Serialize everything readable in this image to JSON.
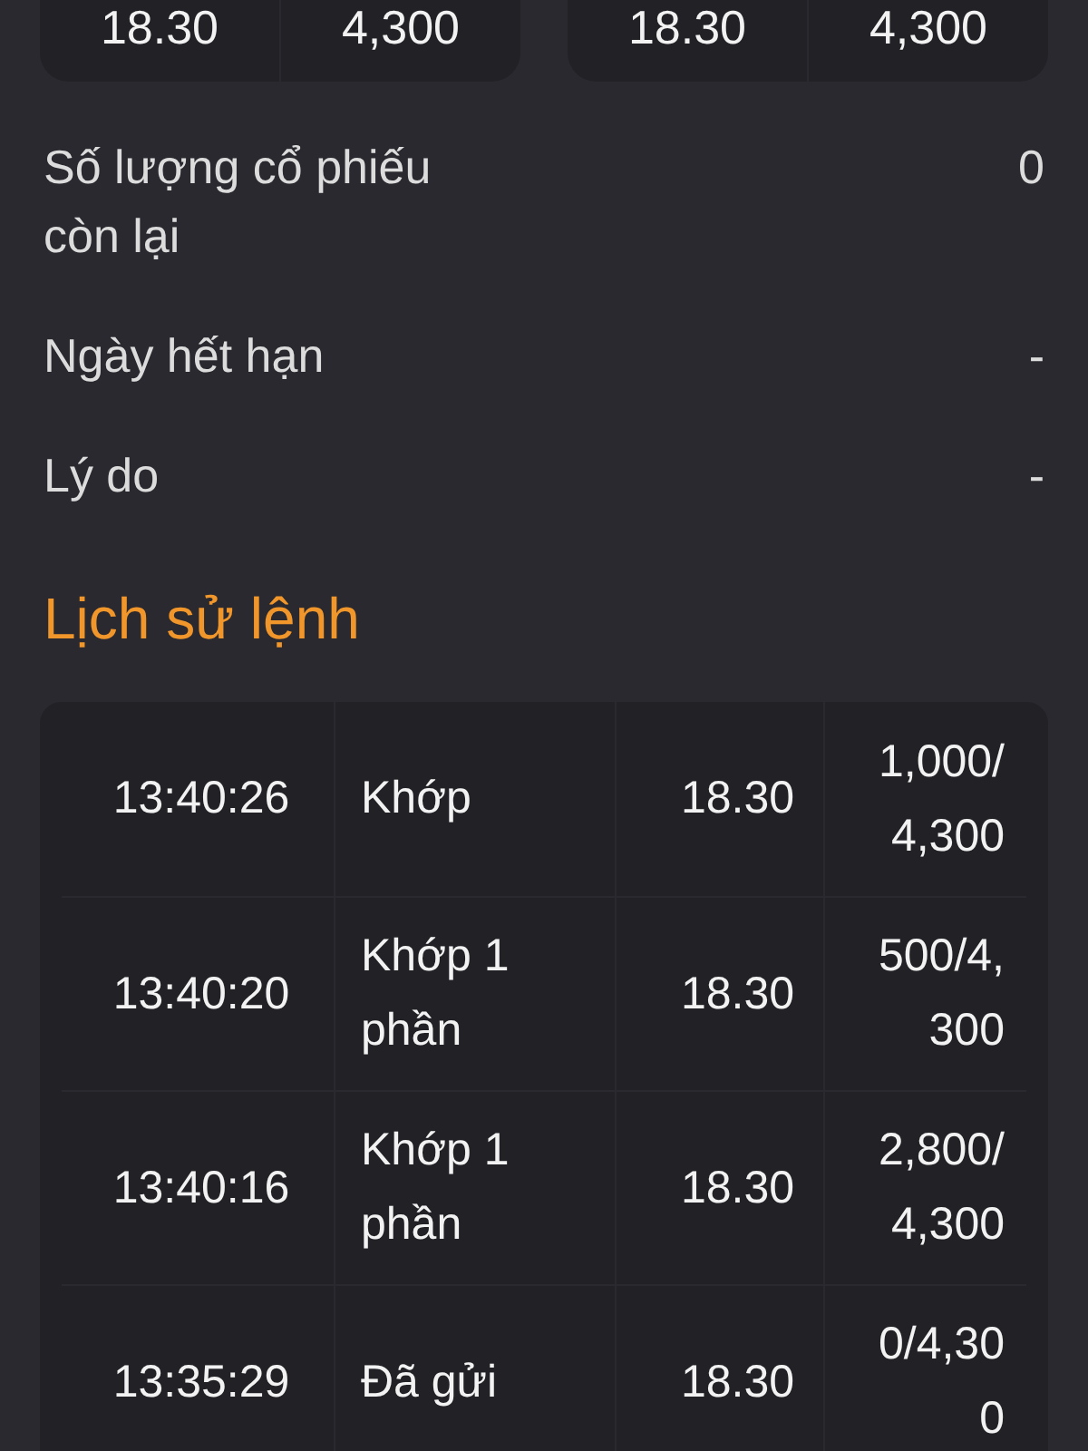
{
  "top_cards": [
    {
      "cells": [
        "18.30",
        "4,300"
      ]
    },
    {
      "cells": [
        "18.30",
        "4,300"
      ]
    }
  ],
  "details": [
    {
      "label": "Số lượng cổ phiếu còn lại",
      "value": "0"
    },
    {
      "label": "Ngày hết hạn",
      "value": "-"
    },
    {
      "label": "Lý do",
      "value": "-"
    }
  ],
  "history": {
    "title": "Lịch sử lệnh",
    "rows": [
      {
        "time": "13:40:26",
        "status": "Khớp",
        "price": "18.30",
        "quantity": "1,000/4,300"
      },
      {
        "time": "13:40:20",
        "status": "Khớp 1 phần",
        "price": "18.30",
        "quantity": "500/4,300"
      },
      {
        "time": "13:40:16",
        "status": "Khớp 1 phần",
        "price": "18.30",
        "quantity": "2,800/4,300"
      },
      {
        "time": "13:35:29",
        "status": "Đã gửi",
        "price": "18.30",
        "quantity": "0/4,300"
      }
    ]
  }
}
